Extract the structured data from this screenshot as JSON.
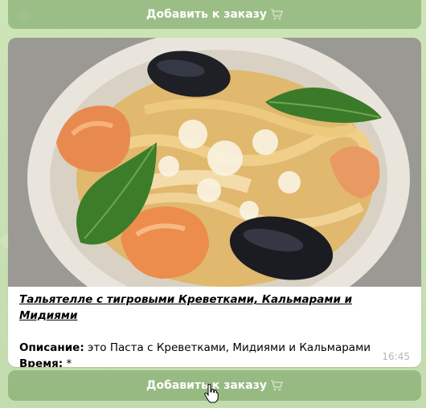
{
  "buttons": {
    "top_label": "Добавить к заказу",
    "bottom_label": "Добавить к заказу",
    "icon": "shopping-cart-icon"
  },
  "message": {
    "title": "Тальятелле с тигровыми Креветками, Кальмарами и Мидиями",
    "description_label": "Описание:",
    "description_text": " это Паста с Креветками, Мидиями и Кальмарами",
    "time_label": "Время:",
    "time_value": " *",
    "timestamp": "16:45"
  },
  "photo": {
    "icon": "pasta-seafood-photo"
  },
  "colors": {
    "chat_bg": "#c7dfb3",
    "button_bg": "#739e5f",
    "bubble_bg": "#ffffff"
  }
}
